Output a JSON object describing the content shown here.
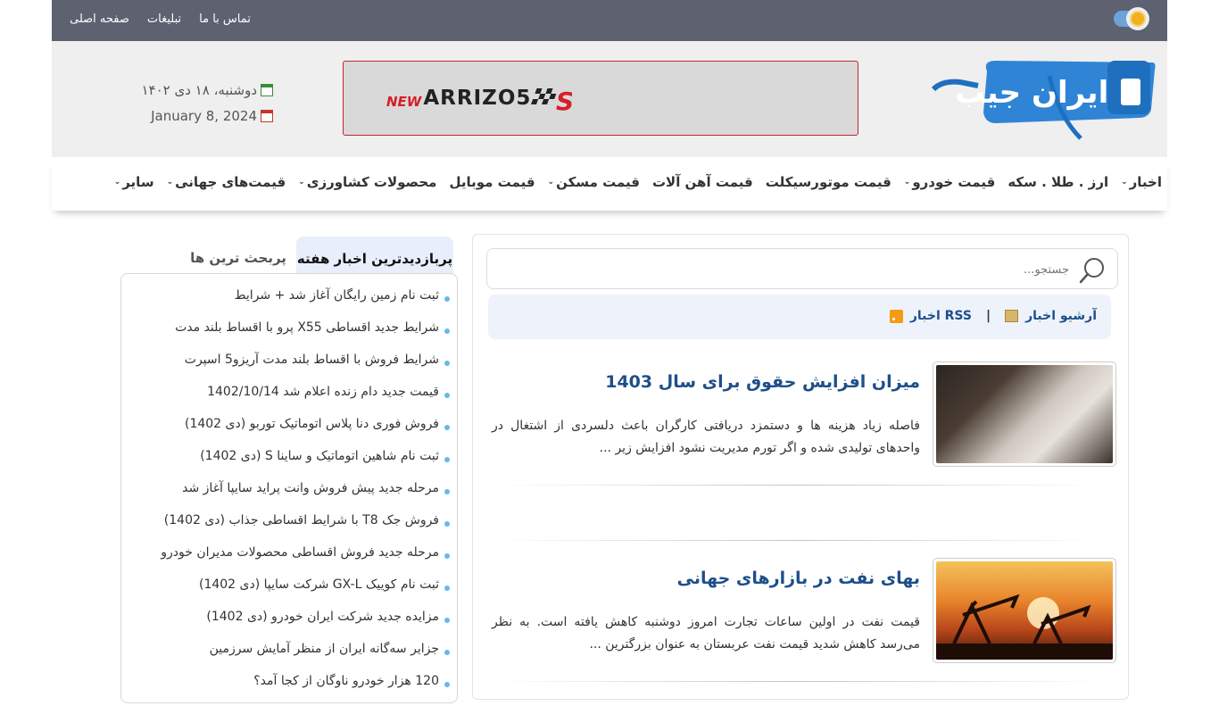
{
  "topbar": {
    "links": [
      "صفحه اصلی",
      "تبلیغات",
      "تماس با ما"
    ]
  },
  "header": {
    "logo_text": "ایران جیب",
    "banner": {
      "new": "NEW",
      "brand": "ARRIZO5",
      "suffix": "S"
    },
    "date_fa": "دوشنبه، ۱۸ دی ۱۴۰۲",
    "date_en": "January 8, 2024"
  },
  "nav": {
    "items": [
      {
        "label": "اخبار",
        "dropdown": true
      },
      {
        "label": "ارز . طلا . سکه",
        "dropdown": false
      },
      {
        "label": "قیمت خودرو",
        "dropdown": true
      },
      {
        "label": "قیمت موتورسیکلت",
        "dropdown": false
      },
      {
        "label": "قیمت آهن آلات",
        "dropdown": false
      },
      {
        "label": "قیمت مسکن",
        "dropdown": true
      },
      {
        "label": "قیمت موبایل",
        "dropdown": false
      },
      {
        "label": "محصولات کشاورزی",
        "dropdown": true
      },
      {
        "label": "قیمت‌های جهانی",
        "dropdown": true
      },
      {
        "label": "سایر",
        "dropdown": true
      }
    ]
  },
  "search": {
    "placeholder": "جستجو..."
  },
  "rssbar": {
    "rss_label": "RSS اخبار",
    "archive_label": "آرشیو اخبار"
  },
  "articles": [
    {
      "title": "میزان افزایش حقوق برای سال 1403",
      "summary": "فاصله زیاد هزینه ها و دستمزد دریافتی کارگران باعث دلسردی از اشتغال در واحدهای تولیدی شده و اگر تورم مدیریت نشود افزایش زیر ..."
    },
    {
      "title": "بهای نفت در بازارهای جهانی",
      "summary": "قیمت نفت در اولین ساعات تجارت امروز دوشنبه کاهش یافته است. به نظر می‌رسد کاهش شدید قیمت نفت عربستان به عنوان بزرگترین ..."
    }
  ],
  "sidebar": {
    "tabs": {
      "active": "پربازدیدترین اخبار هفته",
      "inactive": "پربحث ترین ها"
    },
    "items": [
      "ثبت نام زمین رایگان آغاز شد + شرایط",
      "شرایط جدید اقساطی X55 پرو با اقساط بلند مدت",
      "شرایط فروش با اقساط بلند مدت آریزو5 اسپرت",
      "قیمت جدید دام زنده اعلام شد 1402/10/14",
      "فروش فوری دنا پلاس اتوماتیک توربو (دی 1402)",
      "ثبت نام شاهین اتوماتیک و ساینا S (دی 1402)",
      "مرحله جدید پیش فروش وانت پراید سایپا آغاز شد",
      "فروش جک T8 با شرایط اقساطی جذاب (دی 1402)",
      "مرحله جدید فروش اقساطی محصولات مدیران خودرو",
      "ثبت نام کوییک GX-L شرکت سایپا (دی 1402)",
      "مزایده جدید شرکت ایران خودرو (دی 1402)",
      "جزایر سه‌گانه ایران از منظر آمایش سرزمین",
      "120 هزار خودرو ناوگان از کجا آمد؟"
    ]
  },
  "colors": {
    "topbar_bg": "#5d6170",
    "link_blue": "#1d4f8a",
    "accent_red": "#d71e28",
    "bullet": "#6ab8e8"
  }
}
